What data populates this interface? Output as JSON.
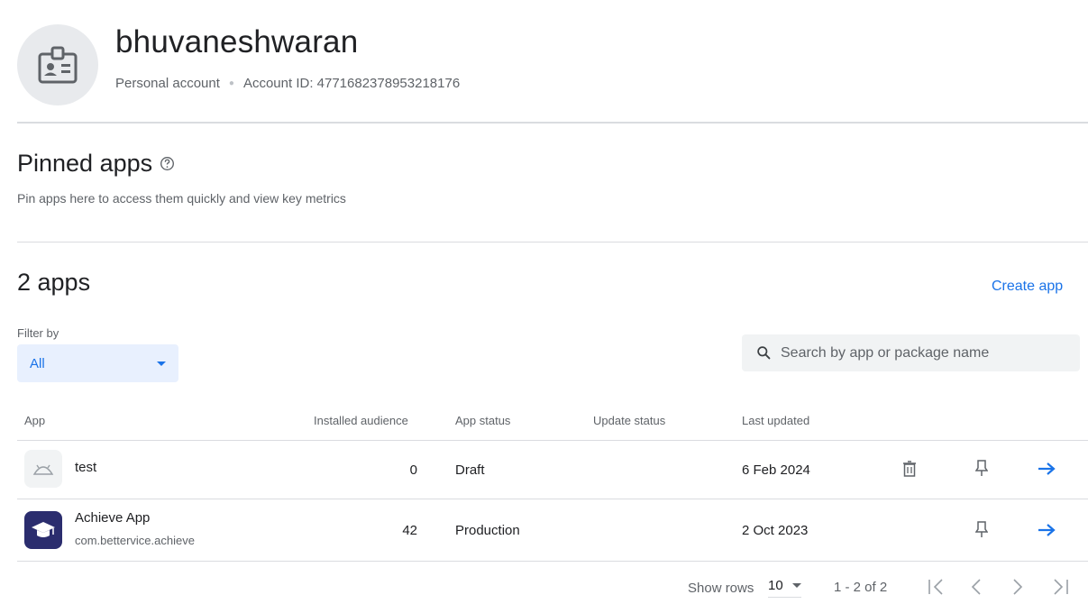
{
  "account": {
    "name": "bhuvaneshwaran",
    "type": "Personal account",
    "id_text": "Account ID: 4771682378953218176"
  },
  "pinned": {
    "title": "Pinned apps",
    "subtitle": "Pin apps here to access them quickly and view key metrics"
  },
  "apps": {
    "count_title": "2 apps",
    "create_label": "Create app",
    "filter_label": "Filter by",
    "filter_value": "All",
    "search_placeholder": "Search by app or package name"
  },
  "table": {
    "headers": {
      "app": "App",
      "installed": "Installed audience",
      "status": "App status",
      "update": "Update status",
      "updated": "Last updated"
    },
    "rows": [
      {
        "name": "test",
        "package": "",
        "icon": "android-placeholder-icon",
        "installed": "0",
        "status": "Draft",
        "update_status": "",
        "last_updated": "6 Feb 2024",
        "has_delete": true
      },
      {
        "name": "Achieve App",
        "package": "com.bettervice.achieve",
        "icon": "graduation-cap-icon",
        "installed": "42",
        "status": "Production",
        "update_status": "",
        "last_updated": "2 Oct 2023",
        "has_delete": false
      }
    ]
  },
  "pagination": {
    "show_rows_label": "Show rows",
    "rows_value": "10",
    "range_text": "1 - 2 of 2"
  },
  "colors": {
    "accent": "#1a73e8",
    "filter_bg": "#e8f0fe",
    "search_bg": "#f1f3f4",
    "app_icon_bg": "#2b2d6e"
  }
}
